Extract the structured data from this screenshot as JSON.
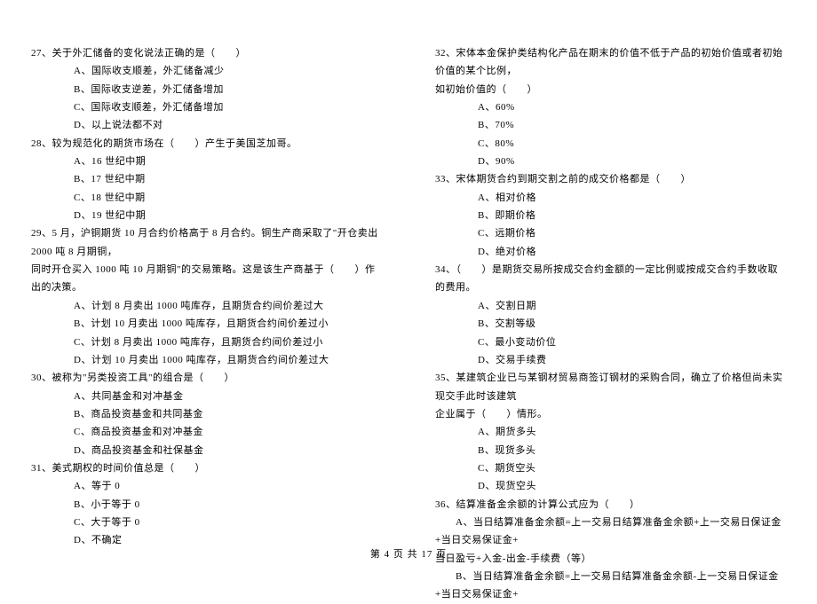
{
  "left_column": {
    "questions": [
      {
        "number": "27",
        "text": "关于外汇储备的变化说法正确的是（　　）",
        "options": [
          "A、国际收支顺差，外汇储备减少",
          "B、国际收支逆差，外汇储备增加",
          "C、国际收支顺差，外汇储备增加",
          "D、以上说法都不对"
        ]
      },
      {
        "number": "28",
        "text": "较为规范化的期货市场在（　　）产生于美国芝加哥。",
        "options": [
          "A、16 世纪中期",
          "B、17 世纪中期",
          "C、18 世纪中期",
          "D、19 世纪中期"
        ]
      },
      {
        "number": "29",
        "text_lines": [
          "29、5 月，沪铜期货 10 月合约价格高于 8 月合约。铜生产商采取了\"开仓卖出 2000 吨 8 月期铜，",
          "同时开仓买入 1000 吨 10 月期铜\"的交易策略。这是该生产商基于（　　）作出的决策。"
        ],
        "options": [
          "A、计划 8 月卖出 1000 吨库存，且期货合约间价差过大",
          "B、计划 10 月卖出 1000 吨库存，且期货合约间价差过小",
          "C、计划 8 月卖出 1000 吨库存，且期货合约间价差过小",
          "D、计划 10 月卖出 1000 吨库存，且期货合约间价差过大"
        ]
      },
      {
        "number": "30",
        "text": "被称为\"另类投资工具\"的组合是（　　）",
        "options": [
          "A、共同基金和对冲基金",
          "B、商品投资基金和共同基金",
          "C、商品投资基金和对冲基金",
          "D、商品投资基金和社保基金"
        ]
      },
      {
        "number": "31",
        "text": "美式期权的时间价值总是（　　）",
        "options": [
          "A、等于 0",
          "B、小于等于 0",
          "C、大于等于 0",
          "D、不确定"
        ]
      }
    ]
  },
  "right_column": {
    "questions": [
      {
        "number": "32",
        "text_lines": [
          "32、宋体本金保护类结构化产品在期末的价值不低于产品的初始价值或者初始价值的某个比例，",
          "如初始价值的（　　）"
        ],
        "options": [
          "A、60%",
          "B、70%",
          "C、80%",
          "D、90%"
        ]
      },
      {
        "number": "33",
        "text": "宋体期货合约到期交割之前的成交价格都是（　　）",
        "options": [
          "A、相对价格",
          "B、即期价格",
          "C、远期价格",
          "D、绝对价格"
        ]
      },
      {
        "number": "34",
        "text": "（　　）是期货交易所按成交合约金额的一定比例或按成交合约手数收取的费用。",
        "options": [
          "A、交割日期",
          "B、交割等级",
          "C、最小变动价位",
          "D、交易手续费"
        ]
      },
      {
        "number": "35",
        "text_lines": [
          "35、某建筑企业已与某钢材贸易商签订钢材的采购合同，确立了价格但尚未实现交手此时该建筑",
          "企业属于（　　）情形。"
        ],
        "options": [
          "A、期货多头",
          "B、现货多头",
          "C、期货空头",
          "D、现货空头"
        ]
      },
      {
        "number": "36",
        "text": "结算准备金余额的计算公式应为（　　）",
        "options_long": [
          "　　A、当日结算准备金余额=上一交易日结算准备金余额+上一交易日保证金+当日交易保证金+",
          "当日盈亏+入金-出金-手续费（等）",
          "　　B、当日结算准备金余额=上一交易日结算准备金余额-上一交易日保证金+当日交易保证金+"
        ]
      }
    ]
  },
  "footer": "第 4 页 共 17 页"
}
